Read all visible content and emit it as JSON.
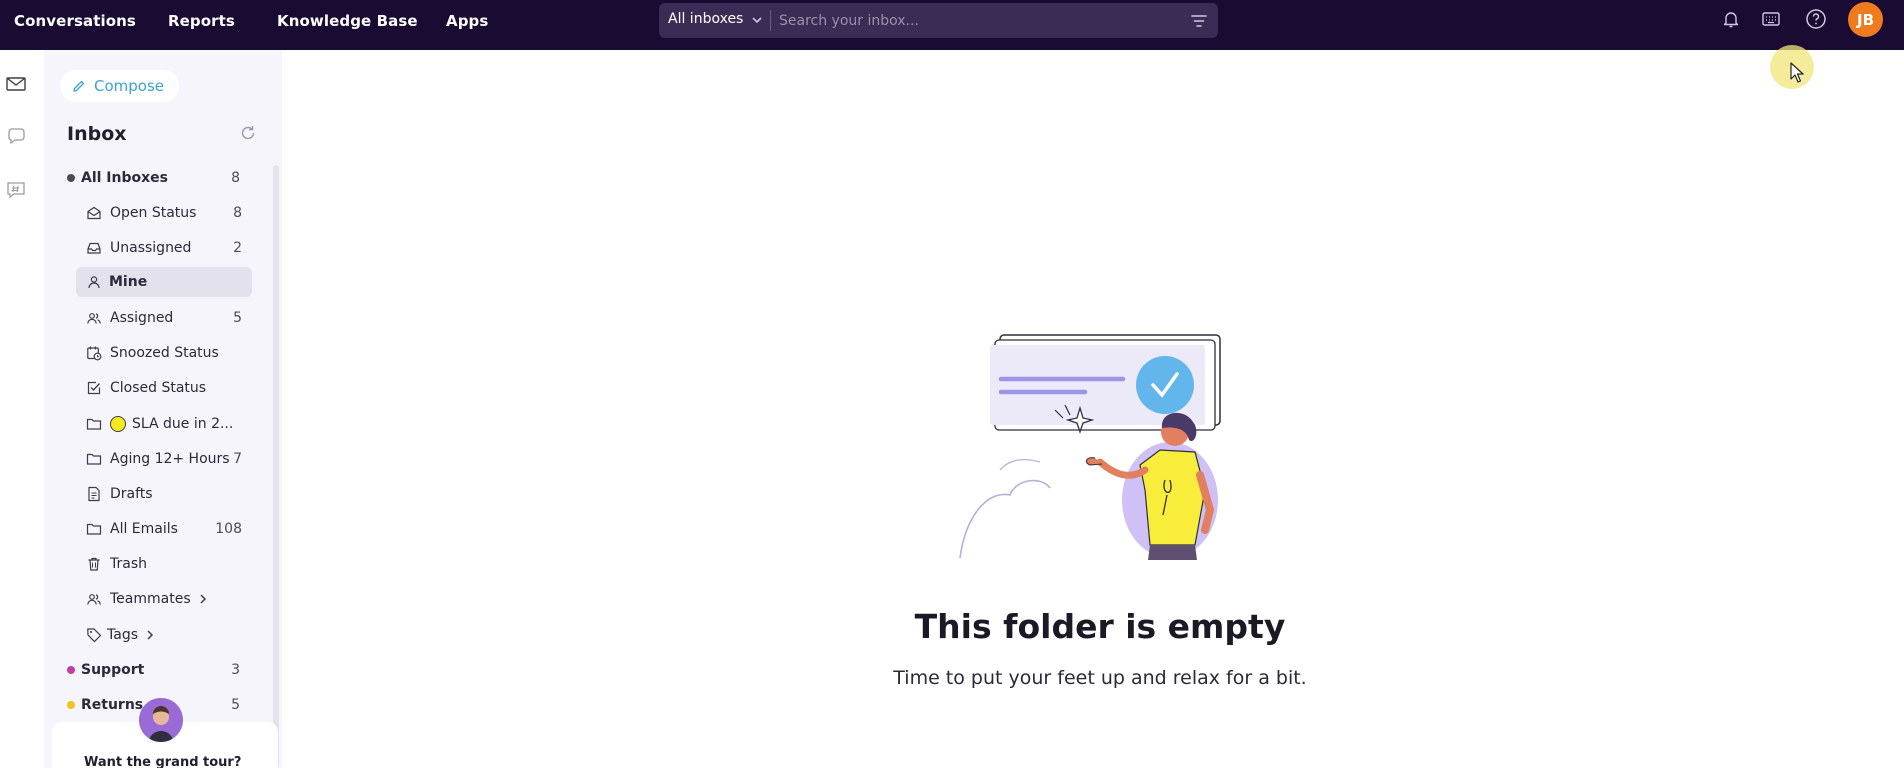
{
  "topnav": {
    "items": [
      "Conversations",
      "Reports",
      "Knowledge Base",
      "Apps"
    ]
  },
  "search": {
    "scope": "All inboxes",
    "placeholder": "Search your inbox..."
  },
  "user": {
    "initials": "JB"
  },
  "compose": {
    "label": "Compose"
  },
  "sidebar": {
    "title": "Inbox",
    "all_inboxes": {
      "label": "All Inboxes",
      "count": "8"
    },
    "folders": [
      {
        "label": "Open Status",
        "count": "8",
        "icon": "envelope-open-icon"
      },
      {
        "label": "Unassigned",
        "count": "2",
        "icon": "inbox-icon"
      },
      {
        "label": "Mine",
        "count": "",
        "icon": "user-icon"
      },
      {
        "label": "Assigned",
        "count": "5",
        "icon": "users-icon"
      },
      {
        "label": "Snoozed Status",
        "count": "",
        "icon": "calendar-clock-icon"
      },
      {
        "label": "Closed Status",
        "count": "",
        "icon": "checkbox-icon"
      },
      {
        "label": "SLA due in 2...",
        "count": "",
        "icon": "folder-icon"
      },
      {
        "label": "Aging 12+ Hours",
        "count": "7",
        "icon": "folder-icon"
      },
      {
        "label": "Drafts",
        "count": "",
        "icon": "document-icon"
      },
      {
        "label": "All Emails",
        "count": "108",
        "icon": "folder-icon"
      },
      {
        "label": "Trash",
        "count": "",
        "icon": "trash-icon"
      },
      {
        "label": "Teammates",
        "count": "",
        "icon": "users-icon"
      },
      {
        "label": "Tags",
        "count": "",
        "icon": "tag-icon"
      }
    ],
    "inboxes": [
      {
        "label": "Support",
        "count": "3",
        "color": "#c13f9e"
      },
      {
        "label": "Returns",
        "count": "5",
        "color": "#f0c419"
      }
    ],
    "tour_text": "Want the grand tour?"
  },
  "empty_state": {
    "title": "This folder is empty",
    "subtitle": "Time to put your feet up and relax for a bit."
  },
  "colors": {
    "topbar": "#1a0b33",
    "accent": "#3aa3d6",
    "avatar": "#f07b1f"
  }
}
